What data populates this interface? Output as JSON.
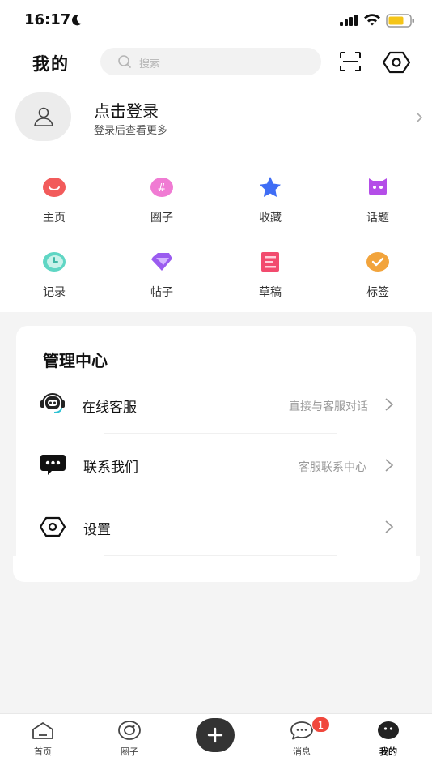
{
  "status_bar": {
    "time": "16:17"
  },
  "header": {
    "title": "我的",
    "search_placeholder": "搜索"
  },
  "profile": {
    "title": "点击登录",
    "subtitle": "登录后查看更多"
  },
  "shortcuts": [
    {
      "label": "主页",
      "icon": "smile-icon",
      "color": "#f25b5b"
    },
    {
      "label": "圈子",
      "icon": "hashtag-icon",
      "color": "#f07bd3"
    },
    {
      "label": "收藏",
      "icon": "star-icon",
      "color": "#3f6df5"
    },
    {
      "label": "话题",
      "icon": "chat-bubble-icon",
      "color": "#b44de8"
    },
    {
      "label": "记录",
      "icon": "clock-icon",
      "color": "#5fd6c4"
    },
    {
      "label": "帖子",
      "icon": "gem-icon",
      "color": "#9b5cf0"
    },
    {
      "label": "草稿",
      "icon": "draft-icon",
      "color": "#f24b6e"
    },
    {
      "label": "标签",
      "icon": "check-badge-icon",
      "color": "#f2a43c"
    }
  ],
  "management": {
    "title": "管理中心",
    "rows": [
      {
        "label": "在线客服",
        "hint": "直接与客服对话",
        "icon": "robot-headset-icon"
      },
      {
        "label": "联系我们",
        "hint": "客服联系中心",
        "icon": "message-icon"
      },
      {
        "label": "设置",
        "hint": "",
        "icon": "settings-icon"
      }
    ]
  },
  "bottom_nav": {
    "items": [
      {
        "label": "首页",
        "icon": "home-icon"
      },
      {
        "label": "圈子",
        "icon": "circle-icon"
      },
      {
        "label": "消息",
        "icon": "message-bubble-icon",
        "badge": "1"
      },
      {
        "label": "我的",
        "icon": "profile-face-icon",
        "active": true
      }
    ],
    "center_action": "plus-icon"
  }
}
